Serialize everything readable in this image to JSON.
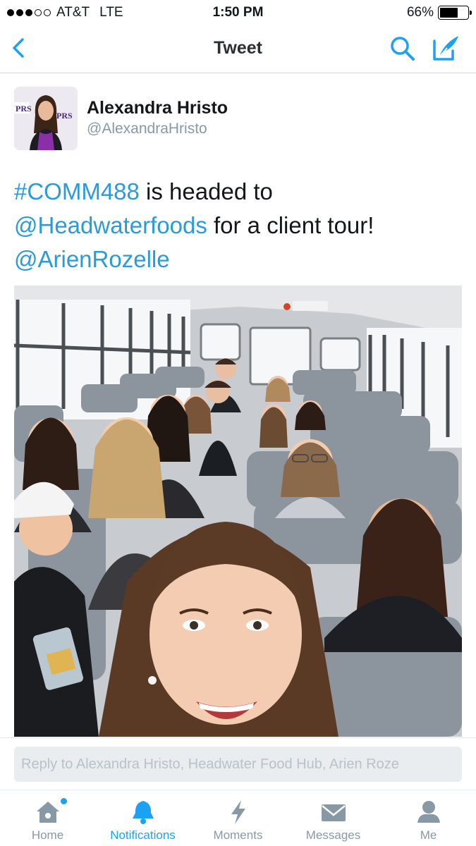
{
  "status_bar": {
    "carrier": "AT&T",
    "network": "LTE",
    "time": "1:50 PM",
    "battery": "66%",
    "battery_level": 0.66,
    "signal_bars_filled": 3,
    "signal_bars_total": 5
  },
  "nav": {
    "title": "Tweet",
    "back_icon": "chevron-left-icon",
    "search_icon": "search-icon",
    "compose_icon": "compose-icon"
  },
  "tweet": {
    "author_name": "Alexandra Hristo",
    "author_handle": "@AlexandraHristo",
    "hashtag": "#COMM488",
    "text_1": " is headed to",
    "mention_1": "@Headwaterfoods",
    "text_2": " for a client tour!",
    "mention_2": "@ArienRozelle",
    "photo_icon": "group-selfie-photo"
  },
  "reply": {
    "placeholder": "Reply to Alexandra Hristo, Headwater Food Hub, Arien Roze"
  },
  "tabs": [
    {
      "label": "Home",
      "icon": "home-icon",
      "active": false,
      "has_notification_dot": true
    },
    {
      "label": "Notifications",
      "icon": "bell-icon",
      "active": true,
      "has_notification_dot": false
    },
    {
      "label": "Moments",
      "icon": "lightning-icon",
      "active": false,
      "has_notification_dot": false
    },
    {
      "label": "Messages",
      "icon": "envelope-icon",
      "active": false,
      "has_notification_dot": false
    },
    {
      "label": "Me",
      "icon": "person-icon",
      "active": false,
      "has_notification_dot": false
    }
  ],
  "colors": {
    "accent": "#1da1f2",
    "link": "#2b9bd8",
    "secondary_text": "#8899a6"
  }
}
